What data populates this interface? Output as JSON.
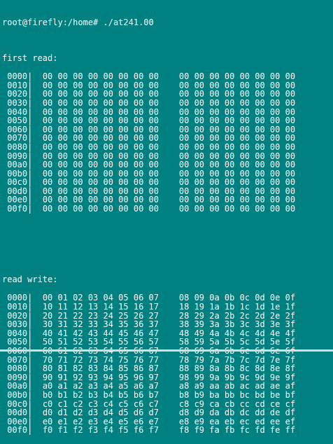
{
  "prompt": "root@firefly:/home# ./at241.00",
  "sections": [
    {
      "title": "first read:",
      "rows": [
        {
          "addr": " 0000|",
          "lo": "00 00 00 00 00 00 00 00",
          "hi": "00 00 00 00 00 00 00 00"
        },
        {
          "addr": " 0010|",
          "lo": "00 00 00 00 00 00 00 00",
          "hi": "00 00 00 00 00 00 00 00"
        },
        {
          "addr": " 0020|",
          "lo": "00 00 00 00 00 00 00 00",
          "hi": "00 00 00 00 00 00 00 00"
        },
        {
          "addr": " 0030|",
          "lo": "00 00 00 00 00 00 00 00",
          "hi": "00 00 00 00 00 00 00 00"
        },
        {
          "addr": " 0040|",
          "lo": "00 00 00 00 00 00 00 00",
          "hi": "00 00 00 00 00 00 00 00"
        },
        {
          "addr": " 0050|",
          "lo": "00 00 00 00 00 00 00 00",
          "hi": "00 00 00 00 00 00 00 00"
        },
        {
          "addr": " 0060|",
          "lo": "00 00 00 00 00 00 00 00",
          "hi": "00 00 00 00 00 00 00 00"
        },
        {
          "addr": " 0070|",
          "lo": "00 00 00 00 00 00 00 00",
          "hi": "00 00 00 00 00 00 00 00"
        },
        {
          "addr": " 0080|",
          "lo": "00 00 00 00 00 00 00 00",
          "hi": "00 00 00 00 00 00 00 00"
        },
        {
          "addr": " 0090|",
          "lo": "00 00 00 00 00 00 00 00",
          "hi": "00 00 00 00 00 00 00 00"
        },
        {
          "addr": " 00a0|",
          "lo": "00 00 00 00 00 00 00 00",
          "hi": "00 00 00 00 00 00 00 00"
        },
        {
          "addr": " 00b0|",
          "lo": "00 00 00 00 00 00 00 00",
          "hi": "00 00 00 00 00 00 00 00"
        },
        {
          "addr": " 00c0|",
          "lo": "00 00 00 00 00 00 00 00",
          "hi": "00 00 00 00 00 00 00 00"
        },
        {
          "addr": " 00d0|",
          "lo": "00 00 00 00 00 00 00 00",
          "hi": "00 00 00 00 00 00 00 00"
        },
        {
          "addr": " 00e0|",
          "lo": "00 00 00 00 00 00 00 00",
          "hi": "00 00 00 00 00 00 00 00"
        },
        {
          "addr": " 00f0|",
          "lo": "00 00 00 00 00 00 00 00",
          "hi": "00 00 00 00 00 00 00 00"
        }
      ]
    },
    {
      "title": "read write:",
      "rows": [
        {
          "addr": " 0000|",
          "lo": "00 01 02 03 04 05 06 07",
          "hi": "08 09 0a 0b 0c 0d 0e 0f"
        },
        {
          "addr": " 0010|",
          "lo": "10 11 12 13 14 15 16 17",
          "hi": "18 19 1a 1b 1c 1d 1e 1f"
        },
        {
          "addr": " 0020|",
          "lo": "20 21 22 23 24 25 26 27",
          "hi": "28 29 2a 2b 2c 2d 2e 2f"
        },
        {
          "addr": " 0030|",
          "lo": "30 31 32 33 34 35 36 37",
          "hi": "38 39 3a 3b 3c 3d 3e 3f"
        },
        {
          "addr": " 0040|",
          "lo": "40 41 42 43 44 45 46 47",
          "hi": "48 49 4a 4b 4c 4d 4e 4f"
        },
        {
          "addr": " 0050|",
          "lo": "50 51 52 53 54 55 56 57",
          "hi": "58 59 5a 5b 5c 5d 5e 5f"
        },
        {
          "addr": " 0060|",
          "lo": "60 61 62 63 64 65 66 67",
          "hi": "68 69 6a 6b 6c 6d 6e 6f"
        },
        {
          "addr": " 0070|",
          "lo": "70 71 72 73 74 75 76 77",
          "hi": "78 79 7a 7b 7c 7d 7e 7f"
        },
        {
          "addr": " 0080|",
          "lo": "80 81 82 83 84 85 86 87",
          "hi": "88 89 8a 8b 8c 8d 8e 8f"
        },
        {
          "addr": " 0090|",
          "lo": "90 91 92 93 94 95 96 97",
          "hi": "98 99 9a 9b 9c 9d 9e 9f"
        },
        {
          "addr": " 00a0|",
          "lo": "a0 a1 a2 a3 a4 a5 a6 a7",
          "hi": "a8 a9 aa ab ac ad ae af"
        },
        {
          "addr": " 00b0|",
          "lo": "b0 b1 b2 b3 b4 b5 b6 b7",
          "hi": "b8 b9 ba bb bc bd be bf"
        },
        {
          "addr": " 00c0|",
          "lo": "c0 c1 c2 c3 c4 c5 c6 c7",
          "hi": "c8 c9 ca cb cc cd ce cf"
        },
        {
          "addr": " 00d0|",
          "lo": "d0 d1 d2 d3 d4 d5 d6 d7",
          "hi": "d8 d9 da db dc dd de df"
        },
        {
          "addr": " 00e0|",
          "lo": "e0 e1 e2 e3 e4 e5 e6 e7",
          "hi": "e8 e9 ea eb ec ed ee ef"
        },
        {
          "addr": " 00f0|",
          "lo": "f0 f1 f2 f3 f4 f5 f6 f7",
          "hi": "f8 f9 fa fb fc fd fe ff"
        }
      ]
    }
  ],
  "colors": {
    "background": "#008080",
    "foreground": "#ffffff"
  }
}
